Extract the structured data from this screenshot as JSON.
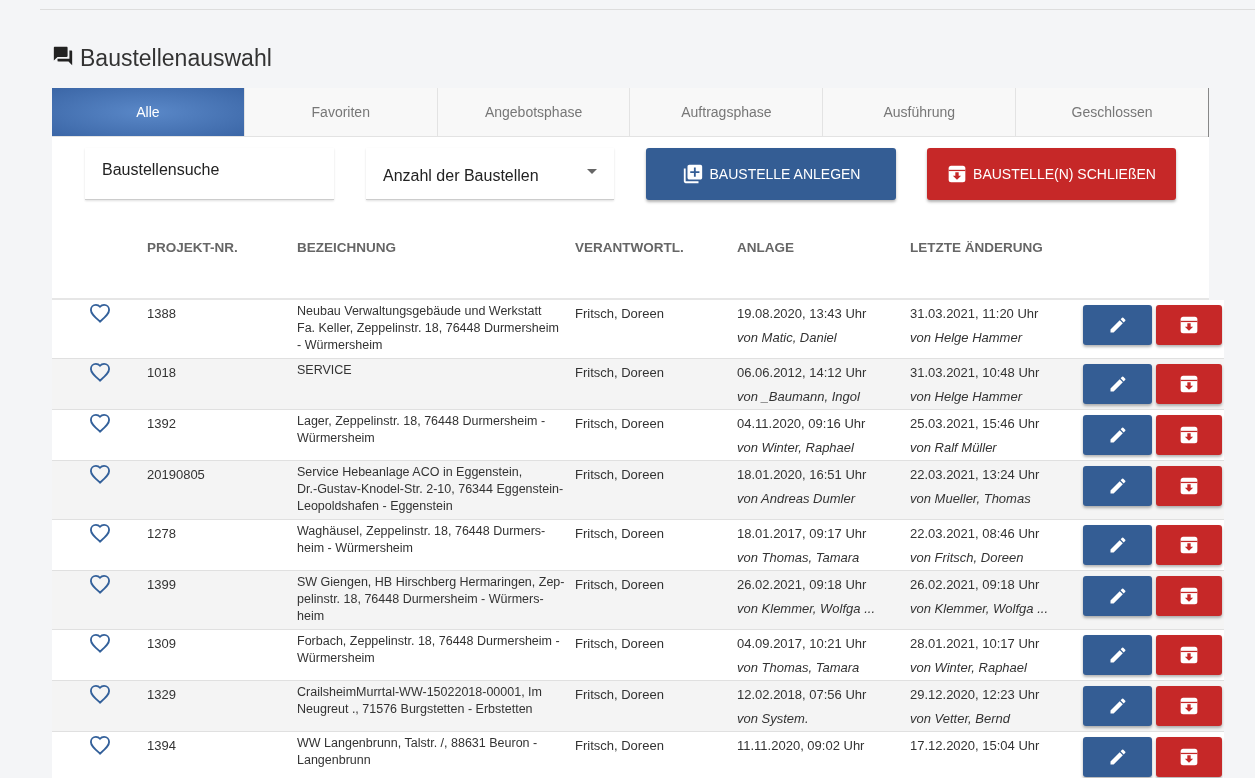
{
  "page": {
    "title": "Baustellenauswahl"
  },
  "tabs": [
    {
      "label": "Alle",
      "selected": true
    },
    {
      "label": "Favoriten",
      "selected": false
    },
    {
      "label": "Angebotsphase",
      "selected": false
    },
    {
      "label": "Auftragsphase",
      "selected": false
    },
    {
      "label": "Ausführung",
      "selected": false
    },
    {
      "label": "Geschlossen",
      "selected": false
    }
  ],
  "search": {
    "placeholder": "Baustellensuche"
  },
  "count_select": {
    "value": "Anzahl der Baustellen"
  },
  "buttons": [
    {
      "label": "BAUSTELLE ANLEGEN",
      "kind": "create"
    },
    {
      "label": "BAUSTELLE(N) SCHLIEßEN",
      "kind": "close"
    }
  ],
  "table": {
    "columns": [
      "PROJEKT-NR.",
      "BEZEICHNUNG",
      "VERANTWORTL.",
      "ANLAGE",
      "LETZTE ÄNDERUNG"
    ],
    "rows": [
      {
        "favorite": false,
        "nr": "1388",
        "name": "Neubau Verwaltungsgebäude und Werkstatt\nFa. Keller, Zeppelinstr. 18, 76448 Durmersheim\n- Würmersheim",
        "owner": "Fritsch, Doreen",
        "created": "19.08.2020, 13:43 Uhr",
        "created_by": "von Matic, Daniel",
        "changed": "31.03.2021, 11:20 Uhr",
        "changed_by": "von Helge Hammer"
      },
      {
        "favorite": false,
        "nr": "1018",
        "name": "SERVICE",
        "owner": "Fritsch, Doreen",
        "created": "06.06.2012, 14:12 Uhr",
        "created_by": "von _Baumann, Ingol",
        "changed": "31.03.2021, 10:48 Uhr",
        "changed_by": "von Helge Hammer"
      },
      {
        "favorite": false,
        "nr": "1392",
        "name": "Lager, Zeppelinstr. 18, 76448 Durmersheim -\nWürmersheim",
        "owner": "Fritsch, Doreen",
        "created": "04.11.2020, 09:16 Uhr",
        "created_by": "von Winter, Raphael",
        "changed": "25.03.2021, 15:46 Uhr",
        "changed_by": "von Ralf Müller"
      },
      {
        "favorite": false,
        "nr": "20190805",
        "name": "Service Hebeanlage ACO in Eggenstein,\nDr.-Gustav-Knodel-Str. 2-10, 76344 Eggenstein-\nLeopoldshafen - Eggenstein",
        "owner": "Fritsch, Doreen",
        "created": "18.01.2020, 16:51 Uhr",
        "created_by": "von Andreas Dumler",
        "changed": "22.03.2021, 13:24 Uhr",
        "changed_by": "von Mueller, Thomas"
      },
      {
        "favorite": false,
        "nr": "1278",
        "name": "Waghäusel, Zeppelinstr. 18, 76448 Durmers-\nheim - Würmersheim",
        "owner": "Fritsch, Doreen",
        "created": "18.01.2017, 09:17 Uhr",
        "created_by": "von Thomas, Tamara",
        "changed": "22.03.2021, 08:46 Uhr",
        "changed_by": "von Fritsch, Doreen"
      },
      {
        "favorite": false,
        "nr": "1399",
        "name": "SW Giengen, HB Hirschberg Hermaringen, Zep-\npelinstr. 18, 76448 Durmersheim - Würmers-\nheim",
        "owner": "Fritsch, Doreen",
        "created": "26.02.2021, 09:18 Uhr",
        "created_by": "von Klemmer, Wolfga ...",
        "changed": "26.02.2021, 09:18 Uhr",
        "changed_by": "von Klemmer, Wolfga ..."
      },
      {
        "favorite": false,
        "nr": "1309",
        "name": "Forbach, Zeppelinstr. 18, 76448 Durmersheim -\nWürmersheim",
        "owner": "Fritsch, Doreen",
        "created": "04.09.2017, 10:21 Uhr",
        "created_by": "von Thomas, Tamara",
        "changed": "28.01.2021, 10:17 Uhr",
        "changed_by": "von Winter, Raphael"
      },
      {
        "favorite": false,
        "nr": "1329",
        "name": "CrailsheimMurrtal-WW-15022018-00001, Im\nNeugreut ., 71576 Burgstetten - Erbstetten",
        "owner": "Fritsch, Doreen",
        "created": "12.02.2018, 07:56 Uhr",
        "created_by": "von System.",
        "changed": "29.12.2020, 12:23 Uhr",
        "changed_by": "von Vetter, Bernd"
      },
      {
        "favorite": false,
        "nr": "1394",
        "name": "WW Langenbrunn, Talstr. /, 88631 Beuron -\nLangenbrunn",
        "owner": "Fritsch, Doreen",
        "created": "11.11.2020, 09:02 Uhr",
        "changed": "17.12.2020, 15:04 Uhr"
      }
    ]
  }
}
